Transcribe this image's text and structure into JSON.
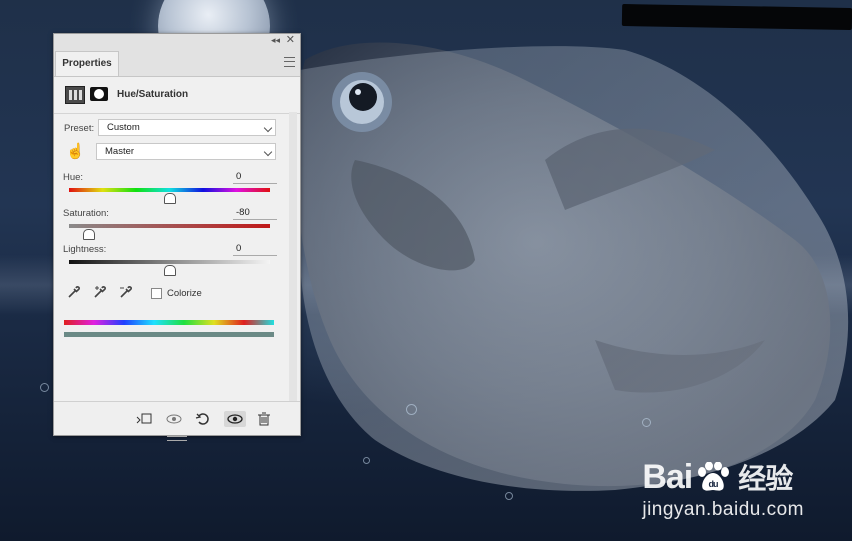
{
  "panel": {
    "tab_label": "Properties",
    "adjustment_title": "Hue/Saturation",
    "preset_label": "Preset:",
    "preset_value": "Custom",
    "channel_value": "Master",
    "hue_label": "Hue:",
    "hue_value": "0",
    "saturation_label": "Saturation:",
    "saturation_value": "-80",
    "lightness_label": "Lightness:",
    "lightness_value": "0",
    "colorize_label": "Colorize",
    "colorize_checked": false
  },
  "icons": {
    "collapse": "double-chevron-left-icon",
    "close": "close-icon",
    "menu": "panel-menu-icon",
    "targeted_adjustment": "hand-icon",
    "eyedroppers": [
      "eyedropper-icon",
      "eyedropper-plus-icon",
      "eyedropper-minus-icon"
    ],
    "bottom": [
      "clip-to-layer-icon",
      "view-previous-icon",
      "reset-icon",
      "visibility-eye-icon",
      "trash-icon"
    ]
  },
  "watermark": {
    "logo_latin": "Bai",
    "logo_du": "du",
    "logo_cn": "经验",
    "url": "jingyan.baidu.com"
  }
}
